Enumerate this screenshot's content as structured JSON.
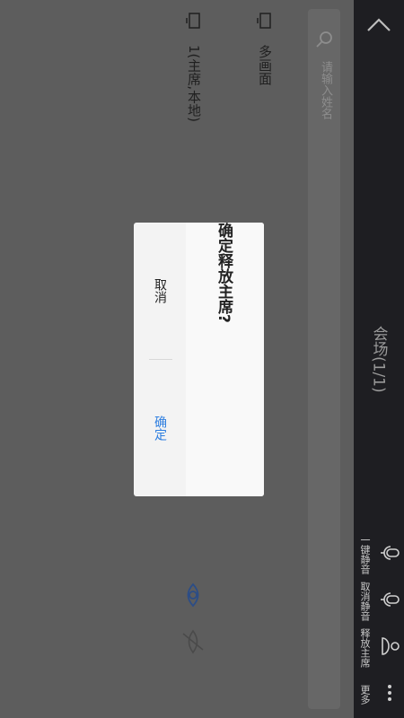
{
  "header": {
    "title": "会场(1/1)"
  },
  "search": {
    "placeholder": "请输入姓名"
  },
  "participants": [
    {
      "name": "多画面"
    },
    {
      "name": "1(主席,本地)"
    }
  ],
  "actions": [
    {
      "label": "一键静音",
      "icon": "mic-icon"
    },
    {
      "label": "取消静音",
      "icon": "mic-unmute-icon"
    },
    {
      "label": "释放主席",
      "icon": "chair-release-icon"
    },
    {
      "label": "更多",
      "icon": "more-icon"
    }
  ],
  "dialog": {
    "message": "确定释放主席?",
    "cancel_label": "取消",
    "confirm_label": "确定",
    "confirm_color": "#2f7fe0"
  },
  "colors": {
    "overlay": "#5d5d5d",
    "header_bg": "#1e1e22"
  }
}
